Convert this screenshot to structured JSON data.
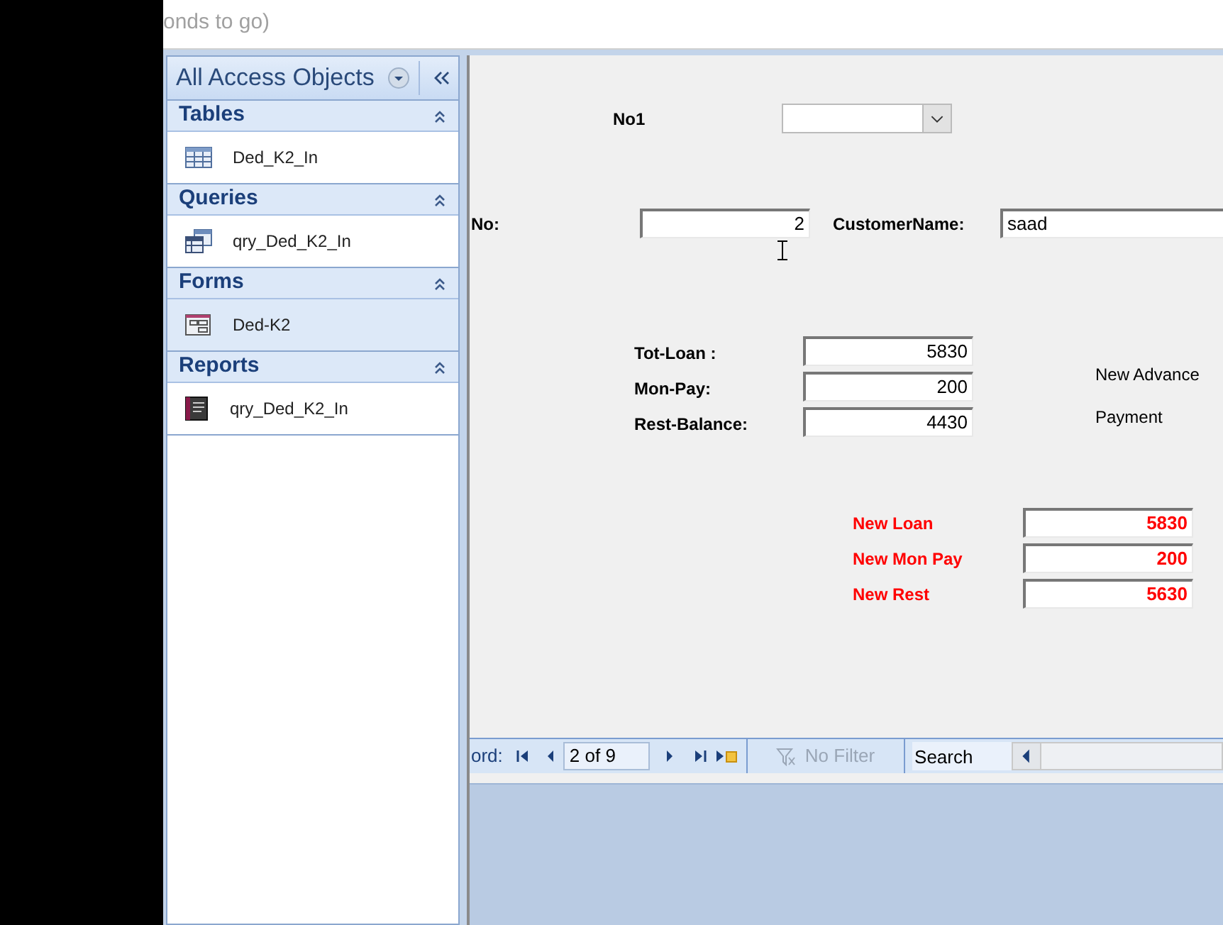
{
  "status_text": "onds to go)",
  "nav_pane": {
    "title": "All Access Objects",
    "groups": [
      {
        "label": "Tables",
        "expanded": true,
        "items": [
          {
            "label": "Ded_K2_In",
            "kind": "table"
          }
        ]
      },
      {
        "label": "Queries",
        "expanded": true,
        "items": [
          {
            "label": "qry_Ded_K2_In",
            "kind": "query"
          }
        ]
      },
      {
        "label": "Forms",
        "expanded": true,
        "items": [
          {
            "label": "Ded-K2",
            "kind": "form",
            "selected": true
          }
        ]
      },
      {
        "label": "Reports",
        "expanded": true,
        "items": [
          {
            "label": "qry_Ded_K2_In",
            "kind": "report",
            "selected": false
          }
        ]
      }
    ]
  },
  "form": {
    "combo": {
      "label": "No1"
    },
    "fields": [
      {
        "label": "No:",
        "value": "2",
        "kind": "plain"
      },
      {
        "label": "CustomerName:",
        "value": "saad",
        "kind": "text"
      },
      {
        "label": "Tot-Loan :",
        "value": "5830",
        "kind": "plain"
      },
      {
        "label": "Mon-Pay:",
        "value": "200",
        "kind": "plain"
      },
      {
        "label": "Rest-Balance:",
        "value": "4430",
        "kind": "plain"
      },
      {
        "label": "New Loan",
        "value": "5830",
        "kind": "highlight"
      },
      {
        "label": "New Mon Pay",
        "value": "200",
        "kind": "highlight"
      },
      {
        "label": "New Rest",
        "value": "5630",
        "kind": "highlight"
      }
    ],
    "notes": [
      "New Advance",
      "Payment"
    ]
  },
  "record_nav": {
    "label": "ord:",
    "position": "2 of 9",
    "filter": {
      "label": "No Filter",
      "active": false
    },
    "search": {
      "placeholder": "Search"
    }
  }
}
